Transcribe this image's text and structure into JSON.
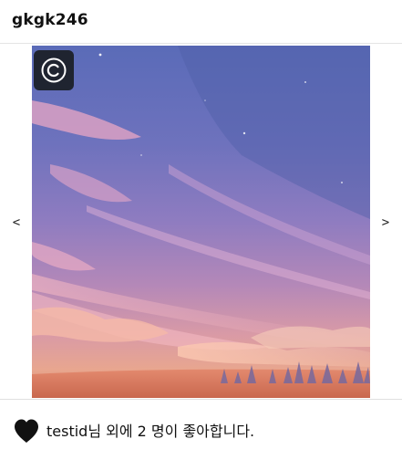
{
  "header": {
    "username": "gkgk246"
  },
  "carousel": {
    "prev_label": "<",
    "next_label": ">",
    "image_alt": "Illustrated pastel sky with clouds at sunset",
    "badge_icon": "copyright-icon",
    "badge_color": "#1f2430"
  },
  "likes": {
    "icon": "heart-icon",
    "icon_color": "#111111",
    "username": "testid",
    "suffix": "님 외에 2 명이 좋아합니다."
  }
}
